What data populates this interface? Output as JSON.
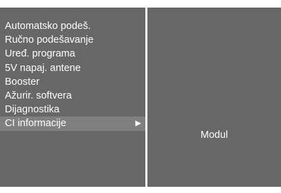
{
  "menu": {
    "items": [
      {
        "label": "Automatsko podeš."
      },
      {
        "label": "Ručno podešavanje"
      },
      {
        "label": "Uređ. programa"
      },
      {
        "label": "5V napaj. antene"
      },
      {
        "label": "Booster"
      },
      {
        "label": "Ažurir. softvera"
      },
      {
        "label": "Dijagnostika"
      },
      {
        "label": "CI informacije",
        "selected": true,
        "submenu_arrow": "right-triangle-icon"
      }
    ]
  },
  "submenu": {
    "items": [
      {
        "label": "Modul"
      }
    ]
  },
  "colors": {
    "panel_bg": "#676767",
    "selected_bg": "#808080",
    "text": "#ffffff",
    "divider": "#ffffff"
  }
}
